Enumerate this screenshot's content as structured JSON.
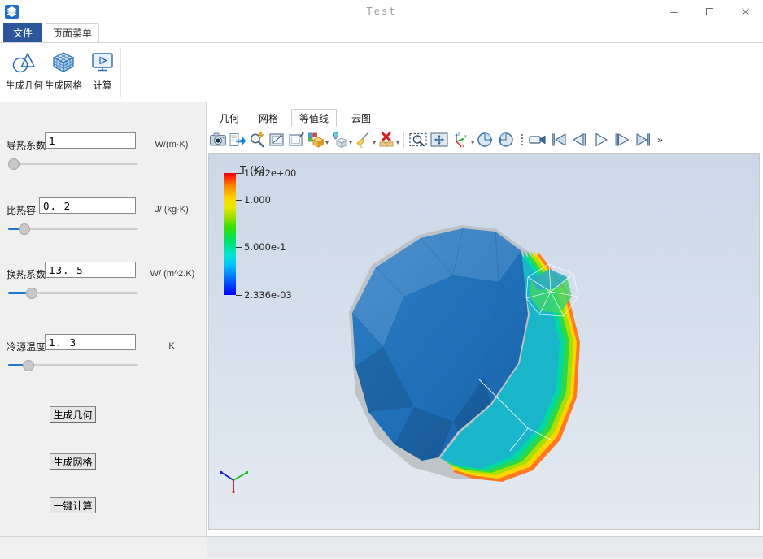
{
  "window": {
    "title": "Test",
    "icon": "app-layers-icon",
    "controls": [
      {
        "name": "minimize-button",
        "glyph": "minimize-icon"
      },
      {
        "name": "maximize-button",
        "glyph": "maximize-icon"
      },
      {
        "name": "close-button",
        "glyph": "close-icon"
      }
    ]
  },
  "ribbon": {
    "tabs": [
      {
        "label": "文件",
        "active": false,
        "style": "file"
      },
      {
        "label": "页面菜单",
        "active": true,
        "style": "page"
      }
    ],
    "buttons": [
      {
        "label": "生成几何",
        "icon": "geometry-shapes-icon"
      },
      {
        "label": "生成网格",
        "icon": "mesh-cube-icon"
      },
      {
        "label": "计算",
        "icon": "run-monitor-icon"
      }
    ]
  },
  "parameters": [
    {
      "label": "导热系数",
      "value": "1",
      "unit": "W/(m·K)",
      "slider": {
        "fill_pct": 0,
        "knob_pct": 0
      }
    },
    {
      "label": "比热容",
      "value": "0. 2",
      "unit": "J/ (kg·K)",
      "slider": {
        "fill_pct": 8,
        "knob_pct": 8
      }
    },
    {
      "label": "换热系数",
      "value": "13. 5",
      "unit": "W/ (m^2.K)",
      "slider": {
        "fill_pct": 13,
        "knob_pct": 13
      }
    },
    {
      "label": "冷源温度",
      "value": "1. 3",
      "unit": "K",
      "slider": {
        "fill_pct": 11,
        "knob_pct": 11
      }
    }
  ],
  "actions": [
    {
      "label": "生成几何",
      "name": "generate-geometry-button"
    },
    {
      "label": "生成网格",
      "name": "generate-mesh-button"
    },
    {
      "label": "一键计算",
      "name": "one-click-compute-button"
    }
  ],
  "viewer": {
    "tabs": [
      {
        "label": "几何",
        "active": false
      },
      {
        "label": "网格",
        "active": false
      },
      {
        "label": "等值线",
        "active": true
      },
      {
        "label": "云图",
        "active": false
      }
    ],
    "toolbar": [
      {
        "name": "screenshot-camera-icon",
        "dropdown": false
      },
      {
        "name": "export-arrow-icon",
        "dropdown": false
      },
      {
        "name": "zoom-magic-icon",
        "dropdown": false
      },
      {
        "name": "select-region-icon",
        "dropdown": false
      },
      {
        "name": "deselect-region-icon",
        "dropdown": false
      },
      {
        "name": "color-by-cube-icon",
        "dropdown": true
      },
      {
        "name": "lighting-bulb-cube-icon",
        "dropdown": true
      },
      {
        "name": "clear-broom-icon",
        "dropdown": true
      },
      {
        "name": "delete-ruler-icon",
        "dropdown": true
      },
      {
        "divider": true
      },
      {
        "name": "zoom-to-box-icon",
        "dropdown": false
      },
      {
        "name": "fit-to-screen-icon",
        "dropdown": false
      },
      {
        "name": "axes-orientation-icon",
        "dropdown": true
      },
      {
        "name": "rotate-ccw-icon",
        "dropdown": false
      },
      {
        "name": "rotate-cw-icon",
        "dropdown": false
      },
      {
        "dots": true
      },
      {
        "name": "record-camera-icon",
        "dropdown": false
      },
      {
        "name": "first-frame-icon",
        "dropdown": false
      },
      {
        "name": "previous-frame-icon",
        "dropdown": false
      },
      {
        "name": "play-icon",
        "dropdown": false
      },
      {
        "name": "next-frame-icon",
        "dropdown": false
      },
      {
        "name": "last-frame-icon",
        "dropdown": false
      },
      {
        "name": "toolbar-overflow-chevron",
        "label": "»"
      }
    ],
    "legend": {
      "title": "T (K)",
      "ticks": [
        {
          "label": "1.282e+00",
          "pos_pct": 100
        },
        {
          "label": "1.000",
          "pos_pct": 78
        },
        {
          "label": "5.000e-1",
          "pos_pct": 39
        },
        {
          "label": "2.336e-03",
          "pos_pct": 0
        }
      ],
      "colors": {
        "min": "#0000ff",
        "mid": "#00e060",
        "max": "#f00000"
      }
    },
    "axes_triad": {
      "x": {
        "label": "x",
        "color": "#e00000"
      },
      "y": {
        "label": "y",
        "color": "#00b000"
      },
      "z": {
        "label": "z",
        "color": "#0000e0"
      }
    }
  },
  "theme": {
    "accent": "#2b579a",
    "panel_bg": "#f0f0f0",
    "viewport_bg": "#d5dfec",
    "slider_fill": "#1a79d0"
  }
}
